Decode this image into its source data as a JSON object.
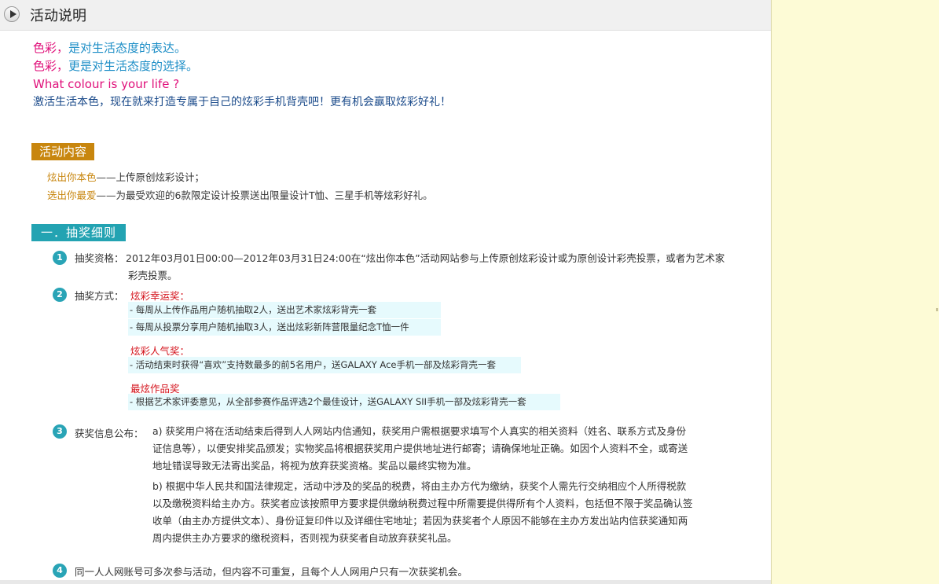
{
  "header": {
    "title": "活动说明"
  },
  "intro": {
    "line1_a": "色彩，",
    "line1_b": "是对生活态度的表达。",
    "line2_a": "色彩，",
    "line2_b": "更是对生活态度的选择。",
    "line3": "What colour is your life ?",
    "line4": "激活生活本色，现在就来打造专属于自己的炫彩手机背壳吧！更有机会赢取炫彩好礼！"
  },
  "content_section": {
    "title": "活动内容",
    "item1_a": "炫出你本色",
    "item1_b": "——上传原创炫彩设计；",
    "item2_a": "选出你最爱",
    "item2_b": "——为最受欢迎的6款限定设计投票送出限量设计T恤、三星手机等炫彩好礼。"
  },
  "rules_section": {
    "title": "一．抽奖细则",
    "r1": {
      "num": "1",
      "label": "抽奖资格：",
      "text1": "2012年03月01日00:00—2012年03月31日24:00在“炫出你本色”活动网站参与上传原创炫彩设计或为原创设计彩壳投票，或者为艺术家",
      "text2": "彩壳投票。"
    },
    "r2": {
      "num": "2",
      "label": "抽奖方式：",
      "prize1": {
        "name": "炫彩幸运奖：",
        "lines": [
          "- 每周从上传作品用户随机抽取2人，送出艺术家炫彩背壳一套",
          "- 每周从投票分享用户随机抽取3人，送出炫彩新阵营限量纪念T恤一件"
        ]
      },
      "prize2": {
        "name": "炫彩人气奖：",
        "lines": [
          "- 活动结束时获得“喜欢”支持数最多的前5名用户，送GALAXY  Ace手机一部及炫彩背壳一套"
        ]
      },
      "prize3": {
        "name": "最炫作品奖",
        "lines": [
          "- 根据艺术家评委意见，从全部参赛作品评选2个最佳设计，送GALAXY SII手机一部及炫彩背壳一套"
        ]
      }
    },
    "r3": {
      "num": "3",
      "label": "获奖信息公布：",
      "a": [
        "a)    获奖用户将在活动结束后得到人人网站内信通知，获奖用户需根据要求填写个人真实的相关资料（姓名、联系方式及身份",
        "证信息等），以便安排奖品颁发；实物奖品将根据获奖用户提供地址进行邮寄；请确保地址正确。如因个人资料不全，或寄送",
        "地址错误导致无法寄出奖品，将视为放弃获奖资格。奖品以最终实物为准。"
      ],
      "b": [
        "b)    根据中华人民共和国法律规定，活动中涉及的奖品的税费，将由主办方代为缴纳，获奖个人需先行交纳相应个人所得税款",
        "以及缴税资料给主办方。获奖者应该按照甲方要求提供缴纳税费过程中所需要提供得所有个人资料，包括但不限于奖品确认签",
        "收单（由主办方提供文本）、身份证复印件以及详细住宅地址；若因为获奖者个人原因不能够在主办方发出站内信获奖通知两",
        "周内提供主办方要求的缴税资料，否则视为获奖者自动放弃获奖礼品。"
      ]
    },
    "r4": {
      "num": "4",
      "text": "同一人人网账号可多次参与活动，但内容不可重复，且每个人人网用户只有一次获奖机会。"
    }
  }
}
